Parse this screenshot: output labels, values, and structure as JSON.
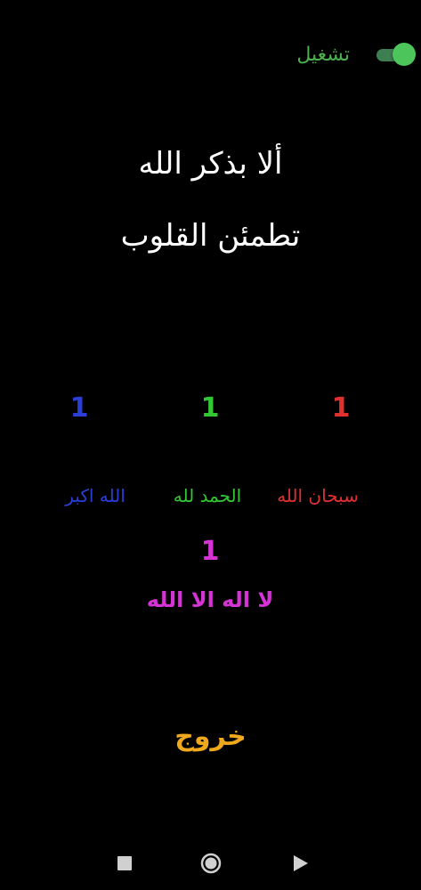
{
  "toggle": {
    "label": "تشغيل",
    "state": "on",
    "label_color": "#4caf50"
  },
  "verse": {
    "line1": "ألا بذكر الله",
    "line2": "تطمئن القلوب"
  },
  "counters": {
    "subhan": {
      "count": "1",
      "label": "سبحان الله",
      "color": "#e03030"
    },
    "hamd": {
      "count": "1",
      "label": "الحمد لله",
      "color": "#33c733"
    },
    "akbar": {
      "count": "1",
      "label": "الله اكبر",
      "color": "#2b3fd6"
    },
    "tahlil": {
      "count": "1",
      "label": "لا اله الا الله",
      "color": "#d633d6"
    }
  },
  "exit": {
    "label": "خروج",
    "color": "#f0a81c"
  },
  "navigation": {
    "buttons": [
      "recents-icon",
      "home-icon",
      "back-icon"
    ]
  }
}
